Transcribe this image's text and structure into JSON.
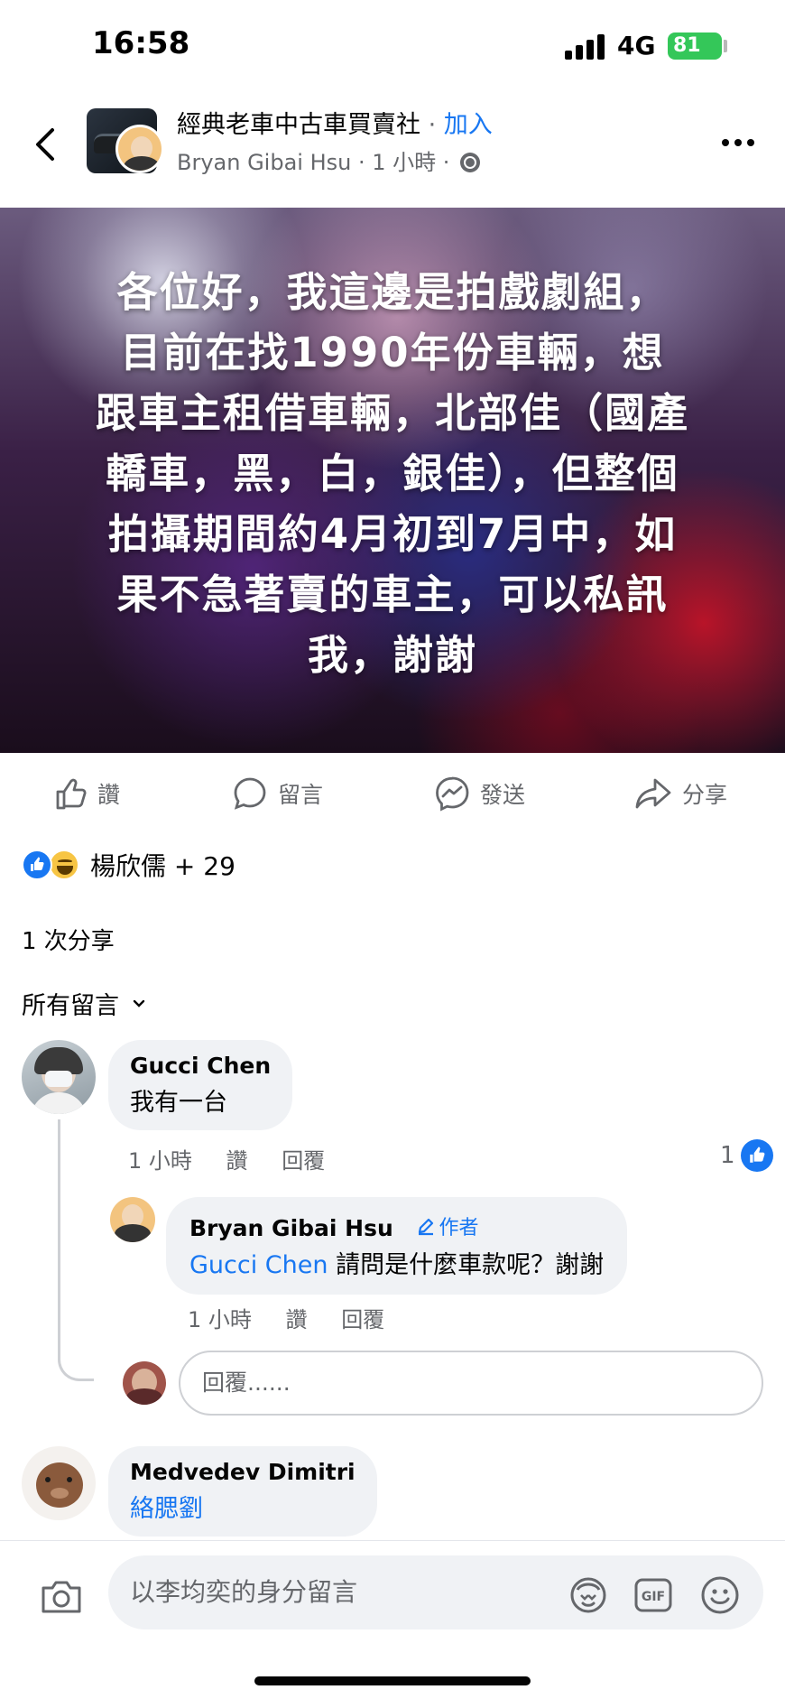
{
  "status_bar": {
    "time": "16:58",
    "network": "4G",
    "battery": "81"
  },
  "header": {
    "group_name": "經典老車中古車買賣社",
    "separator": " · ",
    "join_label": "加入",
    "author": "Bryan Gibai Hsu",
    "time": "1 小時"
  },
  "post": {
    "lines": [
      "各位好，我這邊是拍戲劇組，",
      "目前在找1990年份車輛，想",
      "跟車主租借車輛，北部佳（國產",
      "轎車，黑，白，銀佳），但整個",
      "拍攝期間約4月初到7月中，如",
      "果不急著賣的車主，可以私訊",
      "我，謝謝"
    ]
  },
  "actions": {
    "like": "讚",
    "comment": "留言",
    "send": "發送",
    "share": "分享"
  },
  "reactions": {
    "summary": "楊欣儒 + 29"
  },
  "shares": "1 次分享",
  "comment_filter": "所有留言",
  "comments": [
    {
      "name": "Gucci Chen",
      "text": "我有一台",
      "time": "1 小時",
      "like": "讚",
      "reply": "回覆",
      "like_count": "1"
    },
    {
      "name": "Bryan Gibai Hsu",
      "badge": "作者",
      "mention": "Gucci Chen",
      "text": " 請問是什麼車款呢？謝謝",
      "time": "1 小時",
      "like": "讚",
      "reply": "回覆"
    },
    {
      "name": "Medvedev Dimitri",
      "mention": "絡腮劉"
    }
  ],
  "reply_input": {
    "placeholder": "回覆......"
  },
  "bottom_bar": {
    "placeholder": "以李均奕的身分留言"
  },
  "icons": {
    "back": "chevron-left-icon",
    "more": "more-horizontal-icon",
    "like": "thumbs-up-icon",
    "comment": "comment-icon",
    "send": "messenger-icon",
    "share": "share-arrow-icon",
    "camera": "camera-icon",
    "avatar_sticker": "avatar-sticker-icon",
    "gif": "gif-icon",
    "emoji": "emoji-icon"
  },
  "colors": {
    "accent": "#1877f2",
    "secondary_text": "#65676b",
    "bubble": "#f0f2f5"
  }
}
